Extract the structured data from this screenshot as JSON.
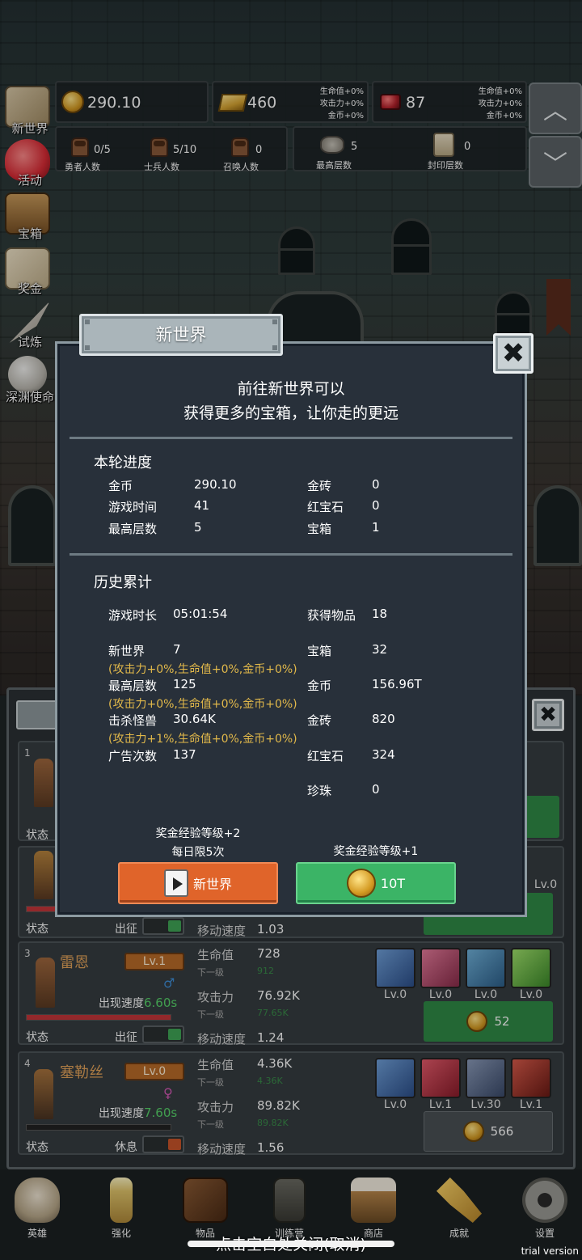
{
  "resources": {
    "gold": "290.10",
    "gold_brick": "460",
    "ruby": "87",
    "brick_bonus": [
      "生命值+0%",
      "攻击力+0%",
      "金币+0%"
    ],
    "ruby_bonus": [
      "生命值+0%",
      "攻击力+0%",
      "金币+0%"
    ]
  },
  "counts": [
    {
      "label": "勇者人数",
      "value": "0/5"
    },
    {
      "label": "士兵人数",
      "value": "5/10"
    },
    {
      "label": "召唤人数",
      "value": "0"
    },
    {
      "label": "最高层数",
      "value": "5"
    },
    {
      "label": "封印层数",
      "value": "0"
    }
  ],
  "side_menu": [
    {
      "label": "新世界",
      "icon": "map-icon"
    },
    {
      "label": "活动",
      "icon": "heart-icon"
    },
    {
      "label": "宝箱",
      "icon": "chest-icon"
    },
    {
      "label": "奖金",
      "icon": "letter-icon"
    },
    {
      "label": "试炼",
      "icon": "feather-icon"
    },
    {
      "label": "深渊使命",
      "icon": "orb-icon"
    }
  ],
  "modal": {
    "tab_title": "新世界",
    "headline_1": "前往新世界可以",
    "headline_2": "获得更多的宝箱，让你走的更远",
    "current_title": "本轮进度",
    "current": {
      "gold_label": "金币",
      "gold": "290.10",
      "time_label": "游戏时间",
      "time": "41",
      "floor_label": "最高层数",
      "floor": "5",
      "brick_label": "金砖",
      "brick": "0",
      "ruby_label": "红宝石",
      "ruby": "0",
      "chest_label": "宝箱",
      "chest": "1"
    },
    "history_title": "历史累计",
    "history": {
      "duration_label": "游戏时长",
      "duration": "05:01:54",
      "items_label": "获得物品",
      "items": "18",
      "newworld_label": "新世界",
      "newworld": "7",
      "newworld_bonus": "(攻击力+0%,生命值+0%,金币+0%)",
      "chest_label": "宝箱",
      "chest": "32",
      "floor_label": "最高层数",
      "floor": "125",
      "floor_bonus": "(攻击力+0%,生命值+0%,金币+0%)",
      "gold_label": "金币",
      "gold": "156.96T",
      "kills_label": "击杀怪兽",
      "kills": "30.64K",
      "kills_bonus": "(攻击力+1%,生命值+0%,金币+0%)",
      "brick_label": "金砖",
      "brick": "820",
      "ads_label": "广告次数",
      "ads": "137",
      "ruby_label": "红宝石",
      "ruby": "324",
      "pearl_label": "珍珠",
      "pearl": "0"
    },
    "left_reward_1": "奖金经验等级+2",
    "left_reward_2": "每日限5次",
    "right_reward": "奖金经验等级+1",
    "btn_new_world": "新世界",
    "btn_cost": "10T"
  },
  "heroes": [
    {
      "num": "1",
      "status": "状态"
    },
    {
      "num": "2",
      "status": "状态",
      "deploy": "出征",
      "speed_label": "移动速度",
      "speed": "1.03"
    },
    {
      "num": "3",
      "name": "雷恩",
      "level": "Lv.1",
      "gender": "♂",
      "appear_label": "出现速度",
      "appear": "6.60s",
      "hp_label": "生命值",
      "hp": "728",
      "hp_next_label": "下一级",
      "hp_next": "912",
      "atk_label": "攻击力",
      "atk": "76.92K",
      "atk_next_label": "下一级",
      "atk_next": "77.65K",
      "speed_label": "移动速度",
      "speed": "1.24",
      "status": "状态",
      "deploy": "出征",
      "equip": [
        "Lv.0",
        "Lv.0",
        "Lv.0",
        "Lv.0"
      ],
      "cost": "52",
      "hp_fill": 1.0
    },
    {
      "num": "4",
      "name": "塞勒丝",
      "level": "Lv.0",
      "gender": "♀",
      "appear_label": "出现速度",
      "appear": "7.60s",
      "hp_label": "生命值",
      "hp": "4.36K",
      "hp_next_label": "下一级",
      "hp_next": "4.36K",
      "atk_label": "攻击力",
      "atk": "89.82K",
      "atk_next_label": "下一级",
      "atk_next": "89.82K",
      "speed_label": "移动速度",
      "speed": "1.56",
      "status": "状态",
      "deploy": "休息",
      "equip": [
        "Lv.0",
        "Lv.1",
        "Lv.30",
        "Lv.1"
      ],
      "cost": "566",
      "hp_fill": 0.0
    }
  ],
  "hero2_extra": {
    "equip_lv": "Lv.0"
  },
  "bottom_nav": [
    {
      "label": "英雄",
      "icon": "skull-icon"
    },
    {
      "label": "强化",
      "icon": "candle-icon"
    },
    {
      "label": "物品",
      "icon": "book-icon"
    },
    {
      "label": "训练营",
      "icon": "lantern-icon"
    },
    {
      "label": "商店",
      "icon": "mug-icon"
    },
    {
      "label": "成就",
      "icon": "key-icon"
    },
    {
      "label": "设置",
      "icon": "gear-icon"
    }
  ],
  "footer": {
    "close_tip": "点击空白处关闭(取消)",
    "trial": "trial version"
  },
  "colors": {
    "accent_orange": "#e0642a",
    "accent_green": "#3bb466",
    "bonus_text": "#e2b94a",
    "modal_bg": "#28303a"
  }
}
